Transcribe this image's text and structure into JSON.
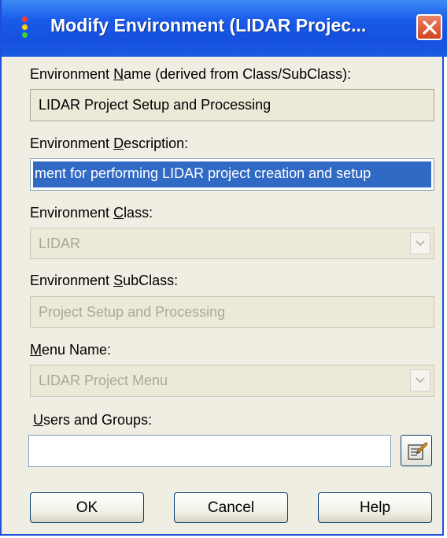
{
  "window": {
    "title": "Modify Environment  (LIDAR Projec..."
  },
  "env_name": {
    "label_pre": "Environment ",
    "label_key": "N",
    "label_post": "ame (derived from Class/SubClass):",
    "value": "LIDAR Project Setup and Processing"
  },
  "env_desc": {
    "label_pre": "Environment ",
    "label_key": "D",
    "label_post": "escription:",
    "value": "ment for performing LIDAR project creation and setup"
  },
  "env_class": {
    "label_pre": "Environment ",
    "label_key": "C",
    "label_post": "lass:",
    "value": "LIDAR"
  },
  "env_subclass": {
    "label_pre": "Environment ",
    "label_key": "S",
    "label_post": "ubClass:",
    "value": "Project Setup and Processing"
  },
  "menu_name": {
    "label_pre": "",
    "label_key": "M",
    "label_post": "enu Name:",
    "value": "LIDAR Project Menu"
  },
  "users_groups": {
    "label_pre": "",
    "label_key": "U",
    "label_post": "sers and Groups:",
    "value": ""
  },
  "buttons": {
    "ok": "OK",
    "cancel": "Cancel",
    "help": "Help"
  },
  "icons": {
    "app": "traffic-light-icon",
    "close": "close-icon",
    "chevron": "chevron-down-icon",
    "browse": "browse-users-icon"
  },
  "colors": {
    "title_bar": "#1550df",
    "selection": "#316ac5",
    "dialog_bg": "#f0eee2",
    "close_button": "#d3431e"
  }
}
